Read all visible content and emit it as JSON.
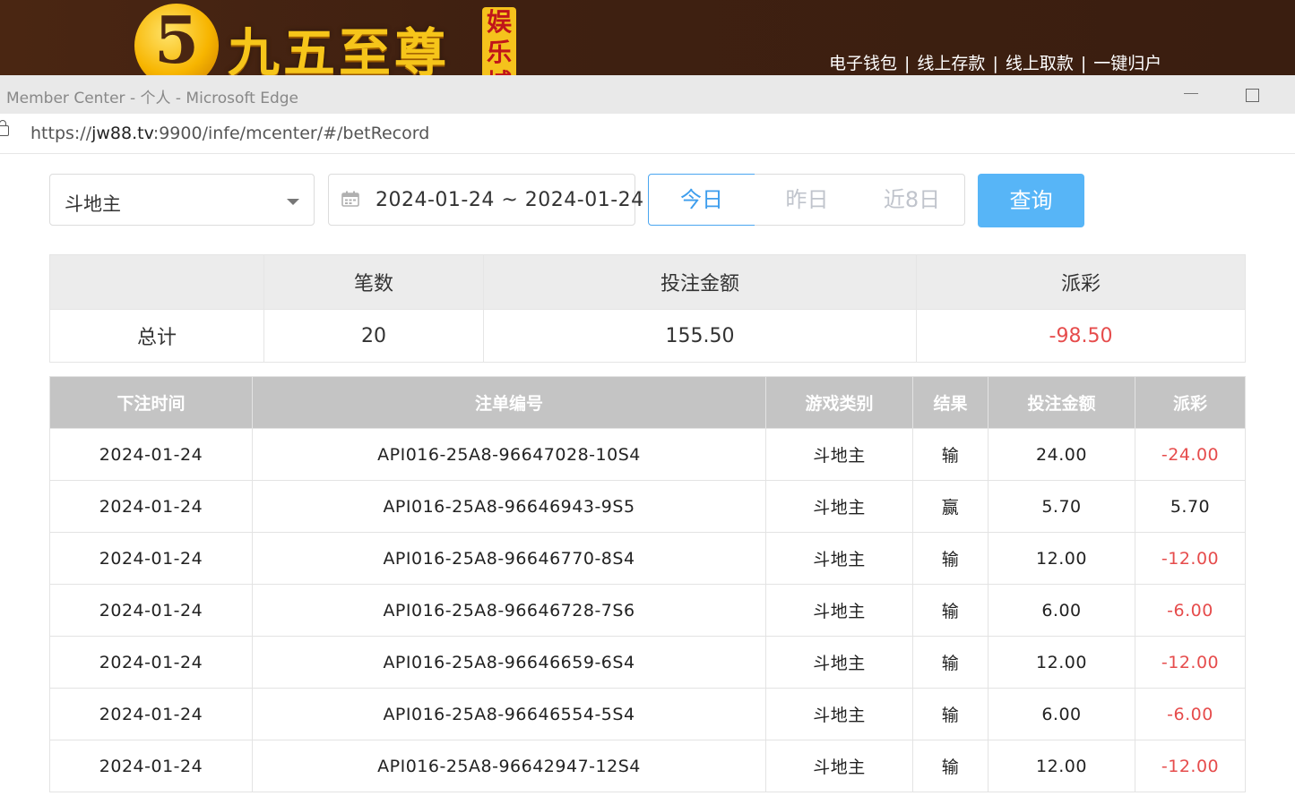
{
  "brand": {
    "logo_glyph": "5",
    "title": "九五至尊",
    "badge": [
      "娱",
      "乐",
      "城"
    ],
    "links": [
      "电子钱包",
      "线上存款",
      "线上取款",
      "一键归户"
    ],
    "separator": "|"
  },
  "window": {
    "title": "Member Center - 个人 - Microsoft Edge",
    "url_scheme": "https://",
    "url_host": "jw88.tv",
    "url_rest": ":9900/infe/mcenter/#/betRecord"
  },
  "filters": {
    "game": "斗地主",
    "date_range": "2024-01-24 ~ 2024-01-24",
    "ranges": [
      "今日",
      "昨日",
      "近8日"
    ],
    "active_range": 0,
    "query_label": "查询"
  },
  "summary": {
    "headers": [
      "",
      "笔数",
      "投注金额",
      "派彩"
    ],
    "row": [
      "总计",
      "20",
      "155.50",
      "-98.50"
    ]
  },
  "records": {
    "headers": [
      "下注时间",
      "注单编号",
      "游戏类别",
      "结果",
      "投注金额",
      "派彩"
    ],
    "rows": [
      [
        "2024-01-24",
        "API016-25A8-96647028-10S4",
        "斗地主",
        "输",
        "24.00",
        "-24.00"
      ],
      [
        "2024-01-24",
        "API016-25A8-96646943-9S5",
        "斗地主",
        "赢",
        "5.70",
        "5.70"
      ],
      [
        "2024-01-24",
        "API016-25A8-96646770-8S4",
        "斗地主",
        "输",
        "12.00",
        "-12.00"
      ],
      [
        "2024-01-24",
        "API016-25A8-96646728-7S6",
        "斗地主",
        "输",
        "6.00",
        "-6.00"
      ],
      [
        "2024-01-24",
        "API016-25A8-96646659-6S4",
        "斗地主",
        "输",
        "12.00",
        "-12.00"
      ],
      [
        "2024-01-24",
        "API016-25A8-96646554-5S4",
        "斗地主",
        "输",
        "6.00",
        "-6.00"
      ],
      [
        "2024-01-24",
        "API016-25A8-96642947-12S4",
        "斗地主",
        "输",
        "12.00",
        "-12.00"
      ]
    ]
  },
  "colors": {
    "negative": "#e64c4c",
    "accent": "#57b5f7",
    "brand_bg": "#3f2011",
    "brand_gold": "#f6c51a"
  }
}
